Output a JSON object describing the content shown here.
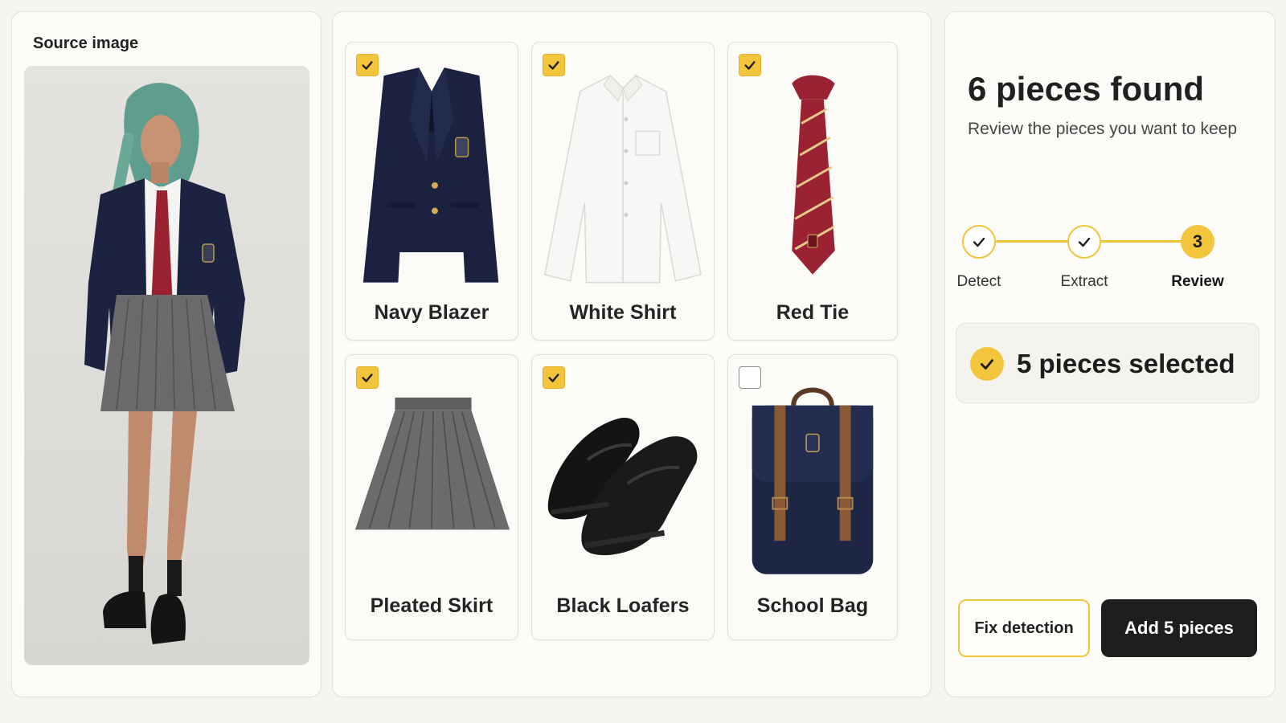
{
  "source": {
    "title": "Source image"
  },
  "items": [
    {
      "label": "Navy Blazer",
      "selected": true,
      "icon": "blazer-image"
    },
    {
      "label": "White Shirt",
      "selected": true,
      "icon": "shirt-image"
    },
    {
      "label": "Red Tie",
      "selected": true,
      "icon": "tie-image"
    },
    {
      "label": "Pleated Skirt",
      "selected": true,
      "icon": "skirt-image"
    },
    {
      "label": "Black Loafers",
      "selected": true,
      "icon": "loafers-image"
    },
    {
      "label": "School Bag",
      "selected": false,
      "icon": "bag-image"
    }
  ],
  "review": {
    "title": "6 pieces found",
    "subtitle": "Review the pieces you want to keep",
    "steps": [
      {
        "label": "Detect",
        "state": "done"
      },
      {
        "label": "Extract",
        "state": "done"
      },
      {
        "label": "Review",
        "state": "current",
        "number": "3"
      }
    ],
    "selected_text": "5 pieces selected",
    "fix_label": "Fix detection",
    "add_label": "Add 5 pieces"
  },
  "colors": {
    "accent": "#f2c53d",
    "dark_button": "#1e1e1e",
    "background": "#f7f5ef"
  }
}
